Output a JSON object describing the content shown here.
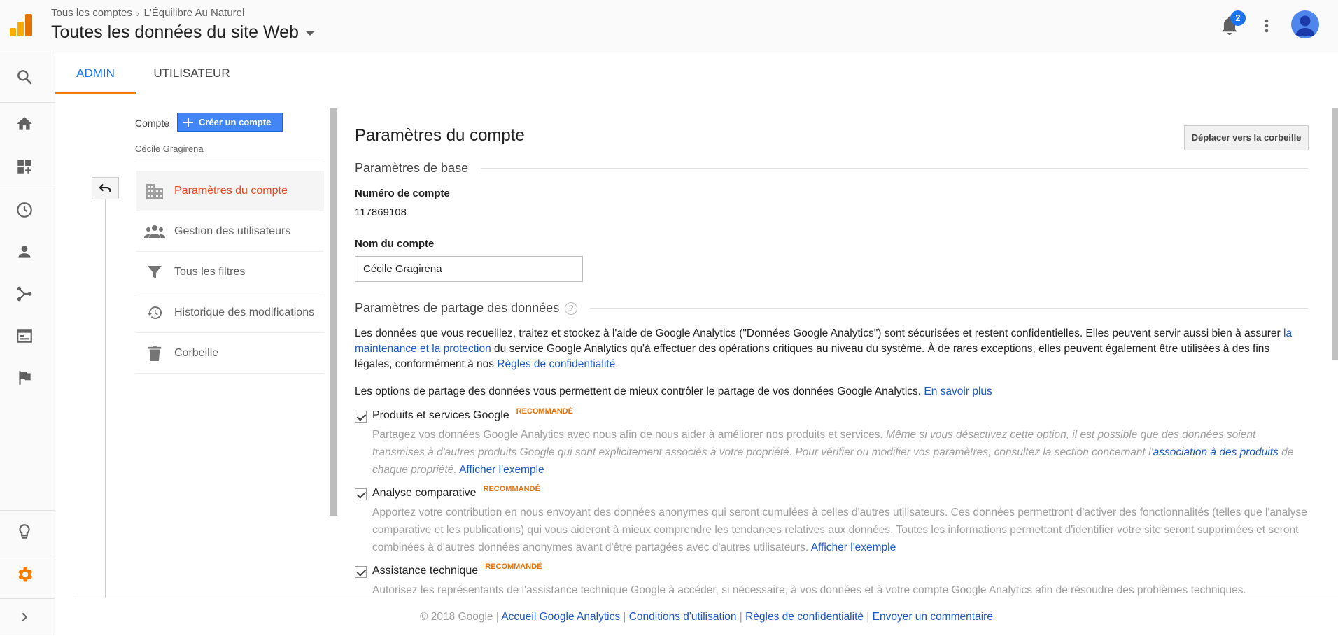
{
  "header": {
    "breadcrumb_root": "Tous les comptes",
    "breadcrumb_account": "L'Équilibre Au Naturel",
    "property_title": "Toutes les données du site Web",
    "notification_count": "2"
  },
  "tabs": {
    "admin": "ADMIN",
    "user": "UTILISATEUR"
  },
  "account_column": {
    "label": "Compte",
    "create_button": "Créer un compte",
    "account_name": "Cécile Gragirena",
    "menu": [
      {
        "label": "Paramètres du compte",
        "icon": "building-icon"
      },
      {
        "label": "Gestion des utilisateurs",
        "icon": "people-icon"
      },
      {
        "label": "Tous les filtres",
        "icon": "filter-icon"
      },
      {
        "label": "Historique des modifications",
        "icon": "history-icon"
      },
      {
        "label": "Corbeille",
        "icon": "trash-icon"
      }
    ]
  },
  "settings": {
    "title": "Paramètres du compte",
    "trash_button": "Déplacer vers la corbeille",
    "basic_section": "Paramètres de base",
    "account_number_label": "Numéro de compte",
    "account_number": "117869108",
    "account_name_label": "Nom du compte",
    "account_name_value": "Cécile Gragirena",
    "sharing_section": "Paramètres de partage des données",
    "help_mark": "?",
    "para1_a": "Les données que vous recueillez, traitez et stockez à l'aide de Google Analytics (\"Données Google Analytics\") sont sécurisées et restent confidentielles. Elles peuvent servir aussi bien à assurer ",
    "para1_link1": "la maintenance et la protection",
    "para1_b": " du service Google Analytics qu'à effectuer des opérations critiques au niveau du système. À de rares exceptions, elles peuvent également être utilisées à des fins légales, conformément à nos ",
    "para1_link2": "Règles de confidentialité",
    "para1_c": ".",
    "para2_a": "Les options de partage des données vous permettent de mieux contrôler le partage de vos données Google Analytics. ",
    "para2_link": "En savoir plus",
    "recommended": "RECOMMANDÉ",
    "options": [
      {
        "title": "Produits et services Google",
        "desc_plain": "Partagez vos données Google Analytics avec nous afin de nous aider à améliorer nos produits et services. ",
        "desc_italic": "Même si vous désactivez cette option, il est possible que des données soient transmises à d'autres produits Google qui sont explicitement associés à votre propriété. Pour vérifier ou modifier vos paramètres, consultez la section concernant l'",
        "desc_link": "association à des produits",
        "desc_italic_tail": " de chaque propriété.",
        "example_link": "Afficher l'exemple"
      },
      {
        "title": "Analyse comparative",
        "desc_plain": "Apportez votre contribution en nous envoyant des données anonymes qui seront cumulées à celles d'autres utilisateurs. Ces données permettront d'activer des fonctionnalités (telles que l'analyse comparative et les publications) qui vous aideront à mieux comprendre les tendances relatives aux données. Toutes les informations permettant d'identifier votre site seront supprimées et seront combinées à d'autres données anonymes avant d'être partagées avec d'autres utilisateurs. ",
        "example_link": "Afficher l'exemple"
      },
      {
        "title": "Assistance technique",
        "desc_plain": "Autorisez les représentants de l'assistance technique Google à accéder, si nécessaire, à vos données et à votre compte Google Analytics afin de résoudre des problèmes techniques."
      }
    ]
  },
  "footer": {
    "copyright": "© 2018 Google",
    "sep": " | ",
    "link1": "Accueil Google Analytics",
    "link2": "Conditions d'utilisation",
    "link3": "Règles de confidentialité",
    "link4": "Envoyer un commentaire"
  },
  "colors": {
    "accent_blue": "#1a73e8",
    "active_orange": "#e8461e",
    "recommended_orange": "#e8710a"
  }
}
